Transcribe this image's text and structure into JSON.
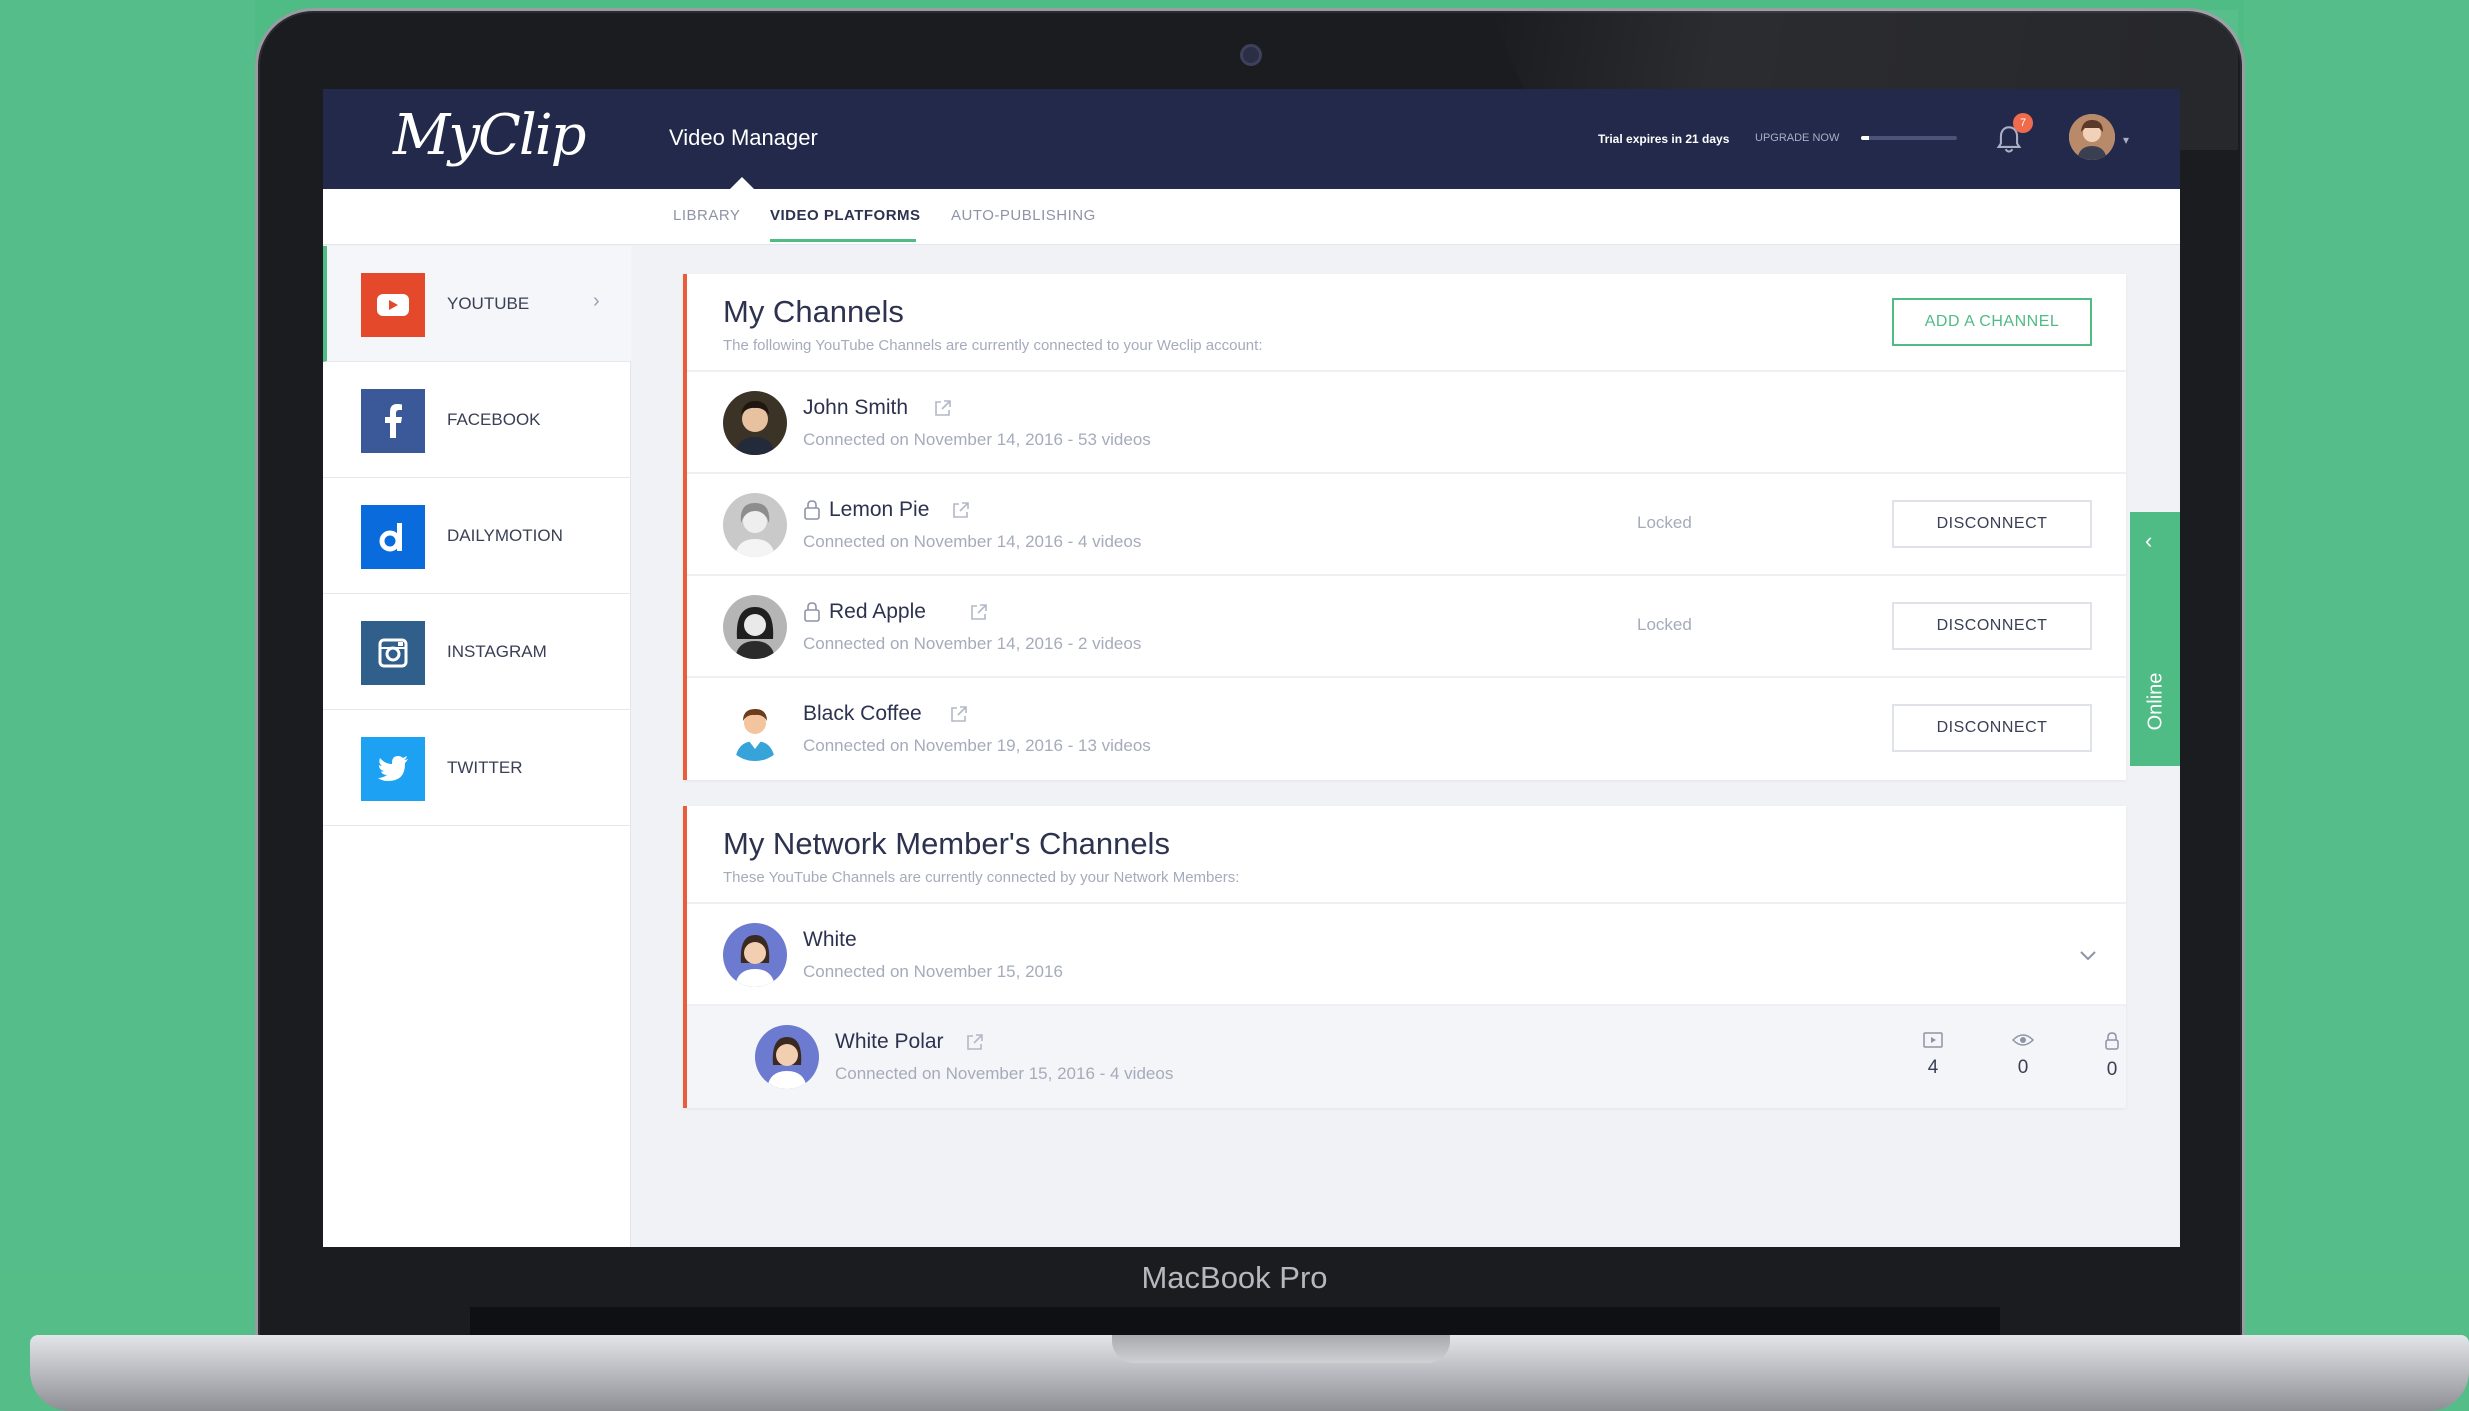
{
  "device": {
    "label": "MacBook Pro"
  },
  "header": {
    "logo": "MyClip",
    "title": "Video Manager",
    "trial_text": "Trial expires in 21 days",
    "upgrade_label": "UPGRADE NOW",
    "trial_progress": 0.08,
    "notification_count": "7"
  },
  "tabs": [
    {
      "label": "LIBRARY",
      "active": false
    },
    {
      "label": "VIDEO PLATFORMS",
      "active": true
    },
    {
      "label": "AUTO-PUBLISHING",
      "active": false
    }
  ],
  "sidebar": {
    "items": [
      {
        "label": "YOUTUBE",
        "icon": "youtube-icon",
        "color": "#e5492c",
        "active": true
      },
      {
        "label": "FACEBOOK",
        "icon": "facebook-icon",
        "color": "#3b5998",
        "active": false
      },
      {
        "label": "DAILYMOTION",
        "icon": "dailymotion-icon",
        "color": "#0a6cdc",
        "active": false
      },
      {
        "label": "INSTAGRAM",
        "icon": "instagram-icon",
        "color": "#2f5f8a",
        "active": false
      },
      {
        "label": "TWITTER",
        "icon": "twitter-icon",
        "color": "#1da1f2",
        "active": false
      }
    ]
  },
  "my_channels": {
    "title": "My Channels",
    "subtitle": "The following YouTube Channels are currently connected to your Weclip account:",
    "add_button": "ADD A CHANNEL",
    "channels": [
      {
        "name": "John Smith",
        "meta": "Connected on November 14, 2016 - 53 videos",
        "locked": false,
        "status": "",
        "action": ""
      },
      {
        "name": "Lemon Pie",
        "meta": "Connected on November 14, 2016 - 4 videos",
        "locked": true,
        "status": "Locked",
        "action": "DISCONNECT"
      },
      {
        "name": "Red Apple",
        "meta": "Connected on November 14, 2016 - 2 videos",
        "locked": true,
        "status": "Locked",
        "action": "DISCONNECT"
      },
      {
        "name": "Black Coffee",
        "meta": "Connected on November 19, 2016 - 13 videos",
        "locked": false,
        "status": "",
        "action": "DISCONNECT"
      }
    ]
  },
  "network_channels": {
    "title": "My Network Member's Channels",
    "subtitle": "These YouTube Channels are currently connected by your Network Members:",
    "member": {
      "name": "White",
      "meta": "Connected on November 15, 2016"
    },
    "sub_channel": {
      "name": "White Polar",
      "meta": "Connected on November 15, 2016 - 4 videos",
      "stats": [
        {
          "icon": "video-icon",
          "value": "4"
        },
        {
          "icon": "eye-icon",
          "value": "0"
        },
        {
          "icon": "lock-icon",
          "value": "0"
        }
      ]
    }
  },
  "online_panel": {
    "label": "Online"
  }
}
